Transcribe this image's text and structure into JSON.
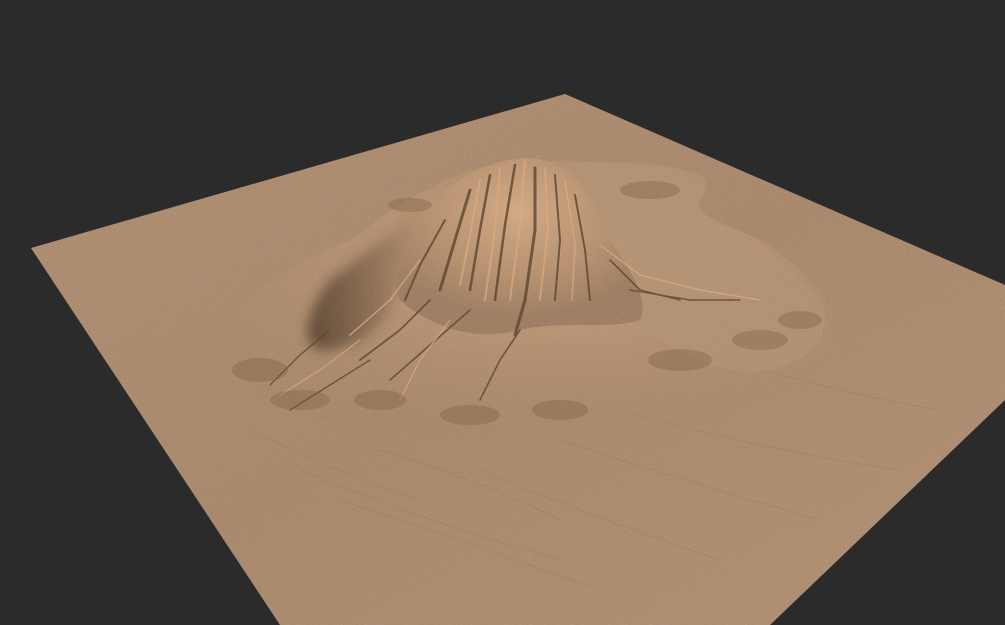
{
  "viewport": {
    "background_color": "#2b2b2b"
  },
  "terrain": {
    "ground_color": "#a8825f",
    "ground_light_color": "#b69172",
    "ground_dark_color": "#8f6c4c",
    "ridge_highlight_color": "#cfa47c",
    "ridge_shadow_color": "#5e4630",
    "description_icon": "terrain-mountain-icon"
  }
}
